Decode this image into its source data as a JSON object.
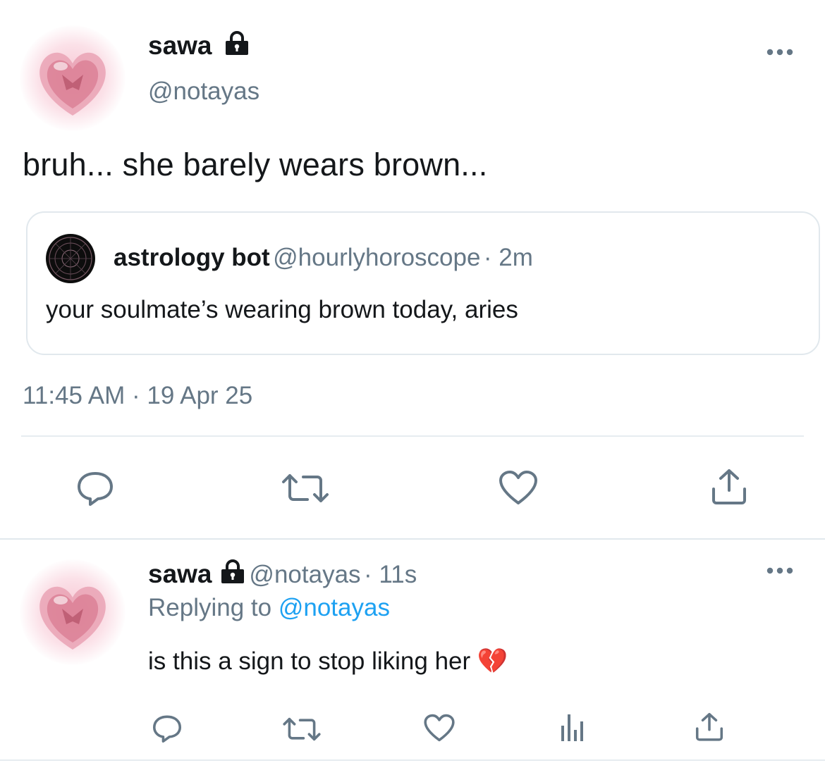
{
  "main_tweet": {
    "author_name": "sawa",
    "handle": "@notayas",
    "text": "bruh... she barely wears brown...",
    "quoted": {
      "author_name": "astrology bot",
      "handle": "@hourlyhoroscope",
      "time": "· 2m",
      "text": "your soulmate’s wearing brown today, aries"
    },
    "timestamp": "11:45 AM · 19 Apr 25"
  },
  "reply_tweet": {
    "author_name": "sawa",
    "handle": "@notayas",
    "time": "· 11s",
    "replying_prefix": "Replying to ",
    "replying_handle": "@notayas",
    "text": "is this a sign to stop liking her 💔"
  },
  "icons": {
    "lock": "lock-icon",
    "more": "more-icon",
    "reply": "reply-icon",
    "retweet": "retweet-icon",
    "like": "like-icon",
    "share": "share-icon",
    "analytics": "analytics-icon"
  },
  "colors": {
    "link": "#1da1f2",
    "secondary": "#657786",
    "text": "#14171a"
  }
}
